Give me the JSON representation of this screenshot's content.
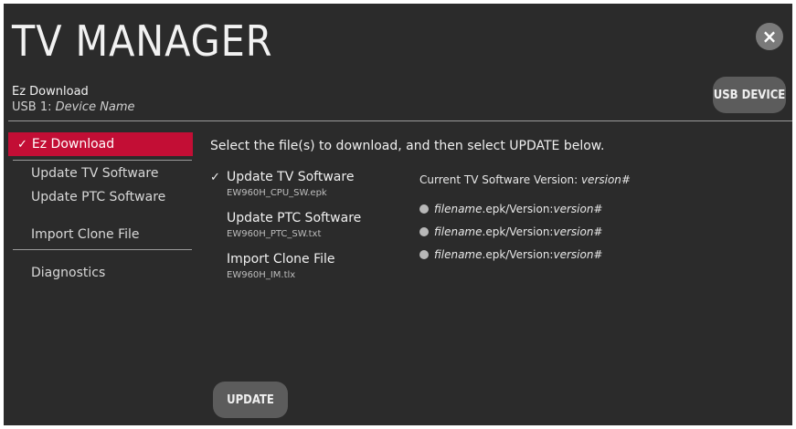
{
  "header": {
    "title": "TV MANAGER",
    "close_icon": "×",
    "section_title": "Ez Download",
    "device_prefix": "USB 1:",
    "device_name": "Device Name",
    "usb_button": "USB DEVICE"
  },
  "sidebar": {
    "check_icon": "✓",
    "items": [
      {
        "label": "Ez Download",
        "active": true
      },
      {
        "label": "Update TV Software"
      },
      {
        "label": "Update PTC Software"
      },
      {
        "label": "Import Clone File"
      },
      {
        "label": "Diagnostics"
      }
    ]
  },
  "main": {
    "instruction": "Select the file(s) to download, and then select UPDATE below.",
    "check_icon": "✓",
    "files": [
      {
        "title": "Update TV Software",
        "filename": "EW960H_CPU_SW.epk",
        "checked": true
      },
      {
        "title": "Update PTC Software",
        "filename": "EW960H_PTC_SW.txt"
      },
      {
        "title": "Import Clone File",
        "filename": "EW960H_IM.tlx"
      }
    ],
    "current_version_label": "Current TV Software Version:",
    "current_version_value": "version#",
    "versions": [
      {
        "filename": "filename",
        "mid": ".epk/Version: ",
        "version": "version#"
      },
      {
        "filename": "filename",
        "mid": ".epk/Version: ",
        "version": "version#"
      },
      {
        "filename": "filename",
        "mid": ".epk/Version: ",
        "version": "version#"
      }
    ],
    "update_button": "UPDATE"
  },
  "colors": {
    "background": "#2b2b2b",
    "active_item": "#c30e35",
    "button": "#5c5c5c"
  }
}
